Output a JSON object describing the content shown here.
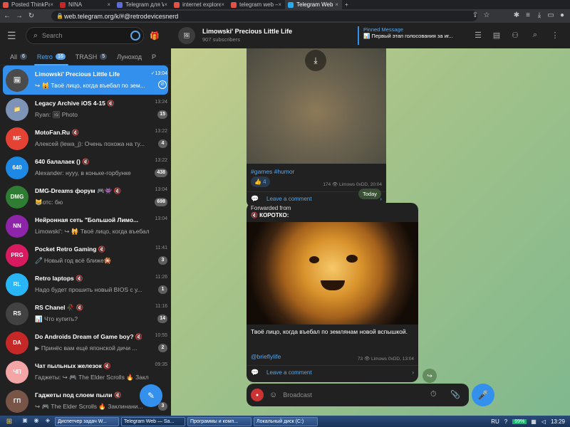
{
  "browser": {
    "tabs": [
      {
        "title": "Posted ThinkPad R60 w",
        "color": "#e0524a"
      },
      {
        "title": "NINA",
        "color": "#c62828"
      },
      {
        "title": "Telegram для Windows",
        "color": "#5f6bd6"
      },
      {
        "title": "internet explorer 9 от",
        "color": "#e0524a"
      },
      {
        "title": "telegram web — Яндек",
        "color": "#e0524a"
      },
      {
        "title": "Telegram Web",
        "color": "#2aabee"
      }
    ],
    "url": "web.telegram.org/k/#@retrodevicesnerd"
  },
  "sidebar": {
    "search_placeholder": "Search",
    "folders": [
      {
        "label": "All",
        "count": "6"
      },
      {
        "label": "Retro",
        "count": "16"
      },
      {
        "label": "TRASH",
        "count": "5"
      },
      {
        "label": "Луноход",
        "count": ""
      },
      {
        "label": "P",
        "count": ""
      }
    ],
    "chats": [
      {
        "name": "Limowski' Precious Little Life",
        "time": "✓13:04",
        "message": "↪ 🙀 Твоё лицо, когда въебал по зем...",
        "badge": "",
        "color": "#4b4b4b",
        "avatar": "🖼"
      },
      {
        "name": "Legacy Archive iOS 4-15 🔇",
        "time": "13:24",
        "message": "Ryan: 🖼 Photo",
        "badge": "15",
        "color": "#7d94b8",
        "avatar": "📁"
      },
      {
        "name": "MotoFan.Ru 🔇",
        "time": "13:22",
        "message": "Алексей (lewa_j): Очень похожа на ту...",
        "badge": "4",
        "color": "#e34234",
        "avatar": "MF"
      },
      {
        "name": "640 балалаек () 🔇",
        "time": "13:22",
        "message": "Alexander: нууу, в коньке-горбунке",
        "badge": "438",
        "color": "#1e88e5",
        "avatar": "640"
      },
      {
        "name": "DMG-Dreams форум 🎮👾 🔇",
        "time": "13:04",
        "message": "😸отс: бю",
        "badge": "698",
        "color": "#2e7d32",
        "avatar": "DMG"
      },
      {
        "name": "Нейронная сеть \"Большой Лимо...",
        "time": "13:04",
        "message": "Limowski': ↪ 🙀 Твоё лицо, когда въебал...",
        "badge": "",
        "color": "#8e24aa",
        "avatar": "NN"
      },
      {
        "name": "Pocket Retro Gaming 🔇",
        "time": "11:41",
        "message": "🧷 Новый год всё ближе🎇",
        "badge": "3",
        "color": "#d81b60",
        "avatar": "PRG"
      },
      {
        "name": "Retro laptops 🔇",
        "time": "11:26",
        "message": "Надо будет прошить новый BIOS с у...",
        "badge": "1",
        "color": "#29b6f6",
        "avatar": "RL"
      },
      {
        "name": "RS Chanel 🥀 🔇",
        "time": "11:16",
        "message": "📊 Что купить?",
        "badge": "14",
        "color": "#424242",
        "avatar": "RS"
      },
      {
        "name": "Do Androids Dream of Game boy? 🔇",
        "time": "10:55",
        "message": "▶ Принёс вам ещё японской дичи ...",
        "badge": "2",
        "color": "#c62828",
        "avatar": "DA"
      },
      {
        "name": "Чат пыльных железок 🔇",
        "time": "09:35",
        "message": "Гаджеты: ↪ 🎮 The Elder Scrolls 🔥 Закл...",
        "badge": "",
        "color": "#f4a6a6",
        "avatar": "ЧП"
      },
      {
        "name": "Гаджеты под слоем пыли 🔇",
        "time": "",
        "message": "↪ 🎮 The Elder Scrolls 🔥 Заклинани...",
        "badge": "3",
        "color": "#795548",
        "avatar": "ГП"
      }
    ]
  },
  "header": {
    "title": "Limowski' Precious Little Life",
    "subscribers": "907 subscribers",
    "pinned_title": "Pinned Message",
    "pinned_text": "📊 Первый этап голосования за иг..."
  },
  "post1": {
    "tags": "#games #humor",
    "reaction": "👍 4",
    "meta": "174 👁 Limows 0xDD, 20:04",
    "comment": "Leave a comment"
  },
  "date_divider": "Today",
  "post2": {
    "forwarded_label": "Forwarded from",
    "forwarded_from": "🔇 КОРОТКО:",
    "text": "Твоё лицо, когда въебал по землянам новой вспышкой.",
    "link": "@brieflylife",
    "meta": "73 👁 Limows 0xDD, 13:04",
    "comment": "Leave a comment"
  },
  "composer": {
    "placeholder": "Broadcast"
  },
  "taskbar": {
    "tasks": [
      "Диспетчер задач W...",
      "Telegram Web — Sa...",
      "Программы и комп...",
      "Локальный диск (C:)"
    ],
    "lang": "RU",
    "battery": "99%",
    "clock": "13:29"
  }
}
